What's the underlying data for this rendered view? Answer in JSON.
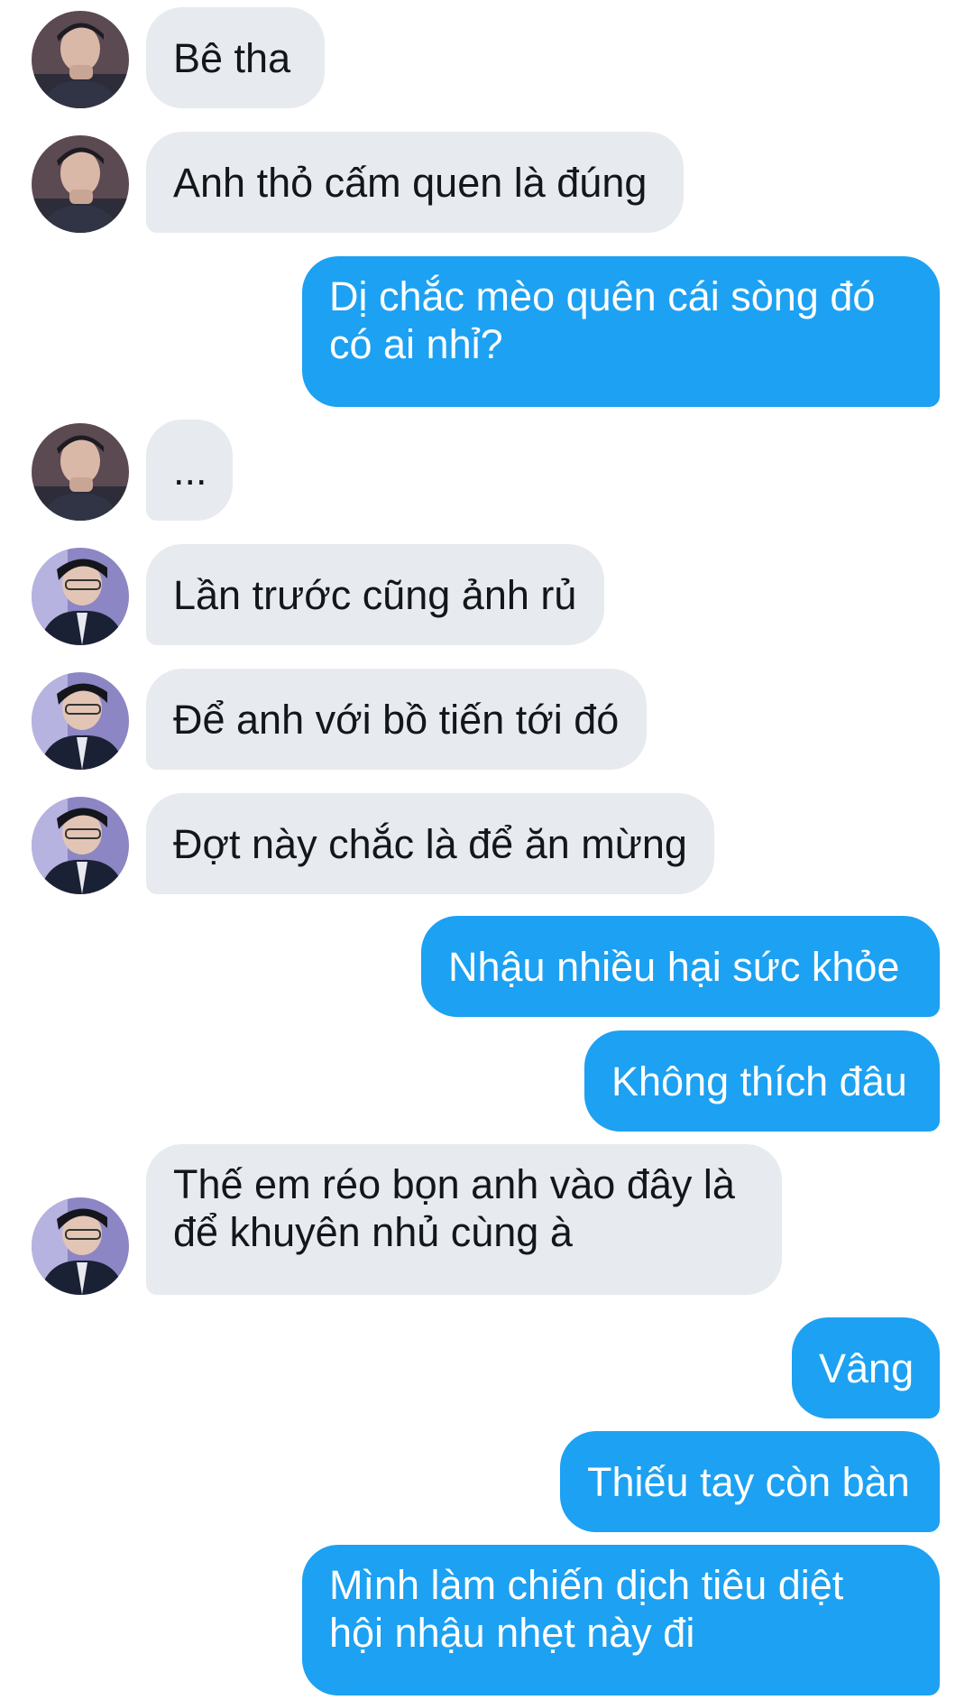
{
  "conversation": {
    "messages": [
      {
        "id": "m1",
        "direction": "incoming",
        "avatar": "profile-photo-a",
        "lines": [
          "Bê tha"
        ]
      },
      {
        "id": "m2",
        "direction": "incoming",
        "avatar": "profile-photo-a",
        "lines": [
          "Anh thỏ cấm quen là đúng"
        ]
      },
      {
        "id": "m3",
        "direction": "outgoing",
        "lines": [
          "Dị chắc mèo quên cái sòng đó",
          "có ai nhỉ?"
        ]
      },
      {
        "id": "m4",
        "direction": "incoming",
        "avatar": "profile-photo-a",
        "lines": [
          "..."
        ]
      },
      {
        "id": "m5",
        "direction": "incoming",
        "avatar": "profile-photo-b",
        "lines": [
          "Lần trước cũng ảnh rủ"
        ]
      },
      {
        "id": "m6",
        "direction": "incoming",
        "avatar": "profile-photo-b",
        "lines": [
          "Để anh với bồ tiến tới đó"
        ]
      },
      {
        "id": "m7",
        "direction": "incoming",
        "avatar": "profile-photo-b",
        "lines": [
          "Đợt này chắc là để ăn mừng"
        ]
      },
      {
        "id": "m8",
        "direction": "outgoing",
        "lines": [
          "Nhậu nhiều hại sức khỏe"
        ]
      },
      {
        "id": "m9",
        "direction": "outgoing",
        "lines": [
          "Không thích đâu"
        ]
      },
      {
        "id": "m10",
        "direction": "incoming",
        "avatar": "profile-photo-b",
        "lines": [
          "Thế em réo bọn anh vào đây là",
          "để khuyên nhủ cùng à"
        ]
      },
      {
        "id": "m11",
        "direction": "outgoing",
        "lines": [
          "Vâng"
        ]
      },
      {
        "id": "m12",
        "direction": "outgoing",
        "lines": [
          "Thiếu tay còn bàn"
        ]
      },
      {
        "id": "m13",
        "direction": "outgoing",
        "lines": [
          "Mình làm chiến dịch tiêu diệt",
          "hội nhậu nhẹt này đi"
        ]
      }
    ]
  },
  "colors": {
    "incoming_bubble": "#e7ebef",
    "incoming_text": "#14171a",
    "outgoing_bubble": "#1da1f2",
    "outgoing_text": "#ffffff",
    "background": "#ffffff"
  }
}
